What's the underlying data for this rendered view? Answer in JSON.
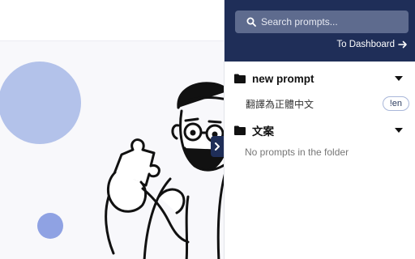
{
  "search": {
    "placeholder": "Search prompts..."
  },
  "header": {
    "dashboard_link": "To Dashboard"
  },
  "folders": [
    {
      "name": "new prompt",
      "prompts": [
        {
          "title": "翻譯為正體中文",
          "shortcut": "!en"
        }
      ]
    },
    {
      "name": "文案",
      "prompts": [],
      "empty_message": "No prompts in the folder"
    }
  ],
  "colors": {
    "header_bg": "#1f2e58",
    "search_bg": "#5e6b8e",
    "circle_large": "#b3c2ea",
    "circle_small": "#8fa2e3"
  }
}
